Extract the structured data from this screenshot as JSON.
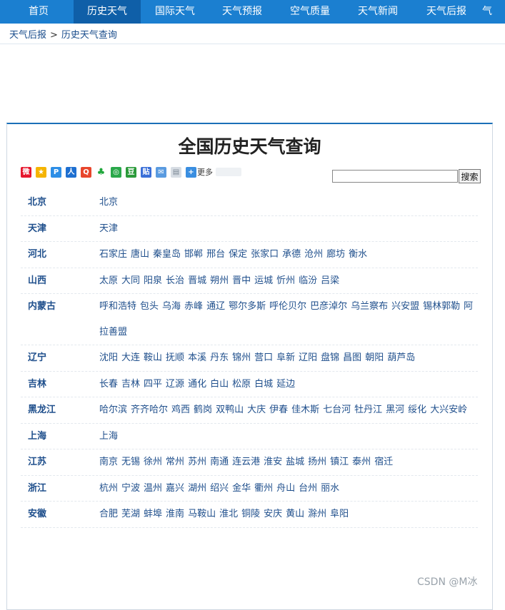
{
  "nav": {
    "items": [
      "首页",
      "历史天气",
      "国际天气",
      "天气预报",
      "空气质量",
      "天气新闻",
      "天气后报",
      "气"
    ],
    "active_index": 1
  },
  "breadcrumb": {
    "home": "天气后报",
    "separator": ">",
    "current": "历史天气查询"
  },
  "panel": {
    "title": "全国历史天气查询",
    "share_more": "更多",
    "search": {
      "value": "",
      "button": "搜索"
    }
  },
  "provinces": [
    {
      "name": "北京",
      "cities": [
        "北京"
      ]
    },
    {
      "name": "天津",
      "cities": [
        "天津"
      ]
    },
    {
      "name": "河北",
      "cities": [
        "石家庄",
        "唐山",
        "秦皇岛",
        "邯郸",
        "邢台",
        "保定",
        "张家口",
        "承德",
        "沧州",
        "廊坊",
        "衡水"
      ]
    },
    {
      "name": "山西",
      "cities": [
        "太原",
        "大同",
        "阳泉",
        "长治",
        "晋城",
        "朔州",
        "晋中",
        "运城",
        "忻州",
        "临汾",
        "吕梁"
      ]
    },
    {
      "name": "内蒙古",
      "cities": [
        "呼和浩特",
        "包头",
        "乌海",
        "赤峰",
        "通辽",
        "鄂尔多斯",
        "呼伦贝尔",
        "巴彦淖尔",
        "乌兰察布",
        "兴安盟",
        "锡林郭勒",
        "阿拉善盟"
      ]
    },
    {
      "name": "辽宁",
      "cities": [
        "沈阳",
        "大连",
        "鞍山",
        "抚顺",
        "本溪",
        "丹东",
        "锦州",
        "营口",
        "阜新",
        "辽阳",
        "盘锦",
        "昌图",
        "朝阳",
        "葫芦岛"
      ]
    },
    {
      "name": "吉林",
      "cities": [
        "长春",
        "吉林",
        "四平",
        "辽源",
        "通化",
        "白山",
        "松原",
        "白城",
        "延边"
      ]
    },
    {
      "name": "黑龙江",
      "cities": [
        "哈尔滨",
        "齐齐哈尔",
        "鸡西",
        "鹤岗",
        "双鸭山",
        "大庆",
        "伊春",
        "佳木斯",
        "七台河",
        "牡丹江",
        "黑河",
        "绥化",
        "大兴安岭"
      ]
    },
    {
      "name": "上海",
      "cities": [
        "上海"
      ]
    },
    {
      "name": "江苏",
      "cities": [
        "南京",
        "无锡",
        "徐州",
        "常州",
        "苏州",
        "南通",
        "连云港",
        "淮安",
        "盐城",
        "扬州",
        "镇江",
        "泰州",
        "宿迁"
      ]
    },
    {
      "name": "浙江",
      "cities": [
        "杭州",
        "宁波",
        "温州",
        "嘉兴",
        "湖州",
        "绍兴",
        "金华",
        "衢州",
        "舟山",
        "台州",
        "丽水"
      ]
    },
    {
      "name": "安徽",
      "cities": [
        "合肥",
        "芜湖",
        "蚌埠",
        "淮南",
        "马鞍山",
        "淮北",
        "铜陵",
        "安庆",
        "黄山",
        "滁州",
        "阜阳"
      ]
    }
  ],
  "watermark": "CSDN @M冰",
  "colors": {
    "nav_bg": "#1b7fd0",
    "nav_active": "#0f5fa8",
    "link": "#1f4f8c",
    "panel_border": "#1b6fb8"
  }
}
